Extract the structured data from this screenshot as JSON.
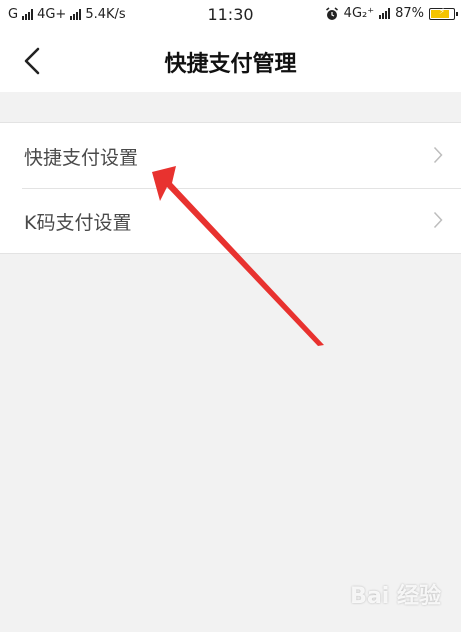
{
  "status_bar": {
    "carrier1": "G",
    "carrier2": "4G+",
    "speed": "5.4K/s",
    "time": "11:30",
    "network": "4G₂⁺",
    "battery": "87%",
    "battery_level": 0.87,
    "alarm_icon": "alarm-clock-icon"
  },
  "nav": {
    "title": "快捷支付管理",
    "back_icon": "chevron-left-icon"
  },
  "list": {
    "items": [
      {
        "label": "快捷支付设置"
      },
      {
        "label": "K码支付设置"
      }
    ]
  },
  "annotation": {
    "color": "#e8322f"
  },
  "watermark": "Bai 经验"
}
